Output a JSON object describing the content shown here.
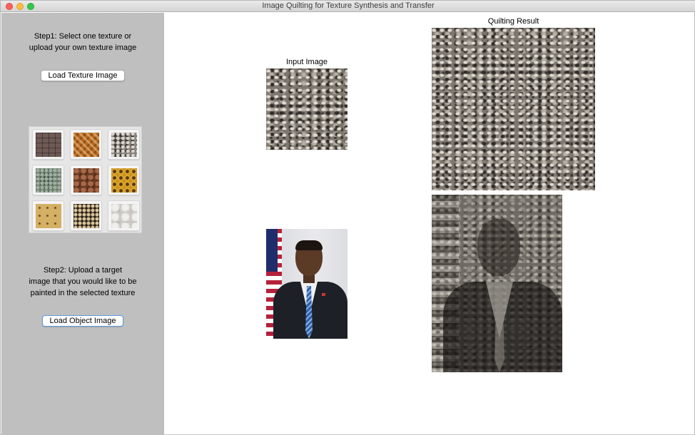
{
  "window": {
    "title": "Image Quilting for Texture Synthesis and Transfer"
  },
  "sidebar": {
    "step1_line1": "Step1: Select one texture or",
    "step1_line2": "upload your own texture image",
    "load_texture_label": "Load Texture Image",
    "swatches": [
      {
        "icon": "brick-texture"
      },
      {
        "icon": "woven-texture"
      },
      {
        "icon": "metal-texture"
      },
      {
        "icon": "pebble-texture"
      },
      {
        "icon": "chocolate-texture"
      },
      {
        "icon": "flower-texture"
      },
      {
        "icon": "cracker-texture"
      },
      {
        "icon": "lattice-texture"
      },
      {
        "icon": "cotton-texture"
      }
    ],
    "step2_line1": "Step2: Upload a target",
    "step2_line2": "image that you would like to be",
    "step2_line3": "painted in the selected texture",
    "load_object_label": "Load Object Image"
  },
  "main": {
    "input_caption": "Input Image",
    "result_caption": "Quilting Result"
  },
  "colors": {
    "sidebar_bg": "#bfbfbf",
    "main_bg": "#ffffff",
    "focus_ring": "#5a9ae6"
  }
}
